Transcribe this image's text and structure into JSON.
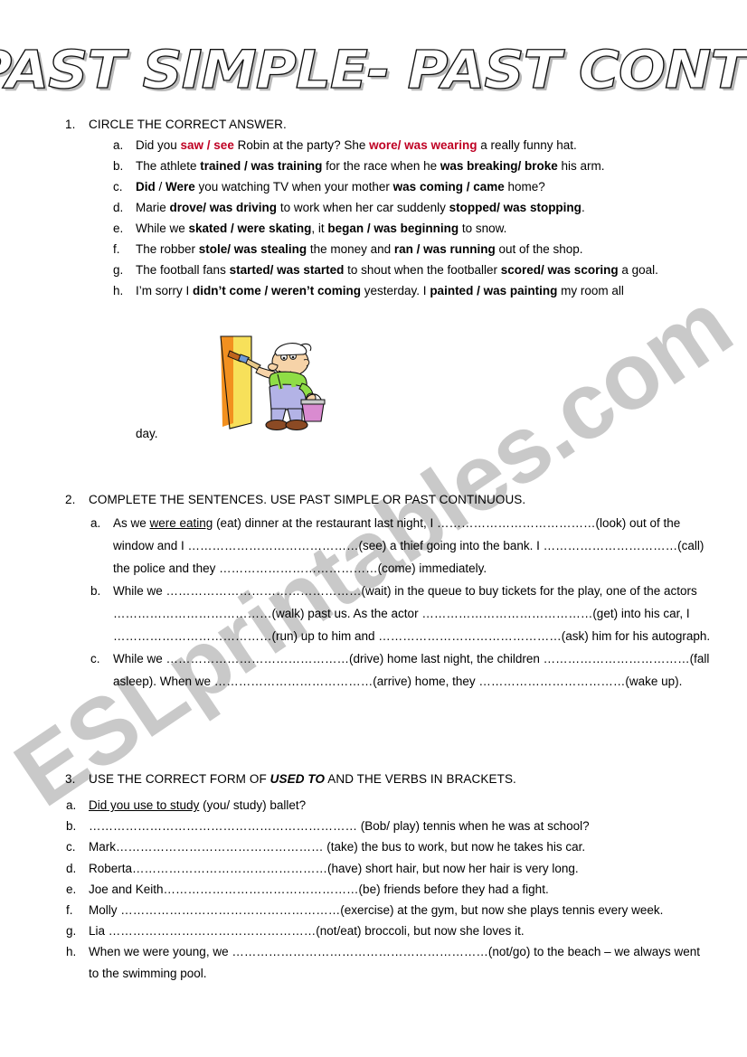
{
  "watermark": {
    "text": "ESLprintables.com"
  },
  "title": {
    "text": "PAST SIMPLE- PAST CONTINUOUS"
  },
  "colors": {
    "accent_red": "#bf0023",
    "watermark_gray": "#c9c9c9",
    "text": "#000000"
  },
  "sections": [
    {
      "number": "1.",
      "heading": "CIRCLE THE CORRECT ANSWER.",
      "items": [
        {
          "letter": "a.",
          "text": "Did you saw / see Robin at the party? She wore/ was wearing a really funny hat."
        },
        {
          "letter": "b.",
          "text": "The athlete trained / was training for the race when he was breaking/ broke his arm."
        },
        {
          "letter": "c.",
          "text": "Did / Were you watching TV when your mother was coming / came home?"
        },
        {
          "letter": "d.",
          "text": "Marie drove/ was driving to work when her car suddenly stopped/ was stopping."
        },
        {
          "letter": "e.",
          "text": "While we skated / were skating, it began / was beginning to snow."
        },
        {
          "letter": "f.",
          "text": "The robber stole/ was stealing the money and ran / was running out of the shop."
        },
        {
          "letter": "g.",
          "text": "The football fans started/ was started to shout when the footballer scored/ was scoring a goal."
        },
        {
          "letter": "h.",
          "text": "I’m sorry I didn’t come / weren’t coming yesterday. I painted / was painting my room all"
        }
      ],
      "trailing_text": "day."
    },
    {
      "number": "2.",
      "heading": "COMPLETE THE SENTENCES. USE PAST SIMPLE OR PAST CONTINUOUS.",
      "items": [
        {
          "letter": "a.",
          "text": "As we were eating (eat) dinner at the restaurant last night, I …………………………………(look) out of the window and I ……………………………………(see) a thief going into the bank. I ……………………………(call) the police and they …………………………………(come) immediately."
        },
        {
          "letter": "b.",
          "text": "While we …………………………………………(wait) in the queue to buy tickets for the play, one of the actors …………………………………(walk) past us. As the actor ……………………………………(get) into his car, I …………………………………(run) up to him and ………………………………………(ask) him for his autograph."
        },
        {
          "letter": "c.",
          "text": "While we ………………………………………(drive) home last night, the children ………………………………(fall asleep). When we …………………………………(arrive) home, they ………………………………(wake up)."
        }
      ],
      "answers_shown": [
        "were eating"
      ]
    },
    {
      "number": "3.",
      "heading": "USE THE CORRECT FORM OF USED TO AND THE VERBS IN BRACKETS.",
      "heading_emphasis": "USED TO",
      "items": [
        {
          "letter": "a.",
          "text": "Did you use to study (you/ study) ballet?"
        },
        {
          "letter": "b.",
          "text": "………………………………………………………… (Bob/ play) tennis when he was at school?"
        },
        {
          "letter": "c.",
          "text": "Mark…………………………………………… (take) the bus to work, but now he takes his car."
        },
        {
          "letter": "d.",
          "text": "Roberta…………………………………………(have) short hair, but now her hair is very long."
        },
        {
          "letter": "e.",
          "text": "Joe and Keith…………………………………………(be) friends before they had a fight."
        },
        {
          "letter": "f.",
          "text": "Molly ………………………………………………(exercise) at the gym, but now she plays tennis every week."
        },
        {
          "letter": "g.",
          "text": "Lia ……………………………………………(not/eat) broccoli, but now she loves it."
        },
        {
          "letter": "h.",
          "text": "When we were young, we ………………………………………………………(not/go) to the beach – we always went to the swimming pool."
        }
      ],
      "answers_shown": [
        "Did you use to study"
      ]
    }
  ],
  "illustration": {
    "name": "painter-clipart",
    "description": "Cartoon man painting a wall with a brush and holding a paint bucket",
    "colors": {
      "wall": "#f7c948",
      "wall_shade": "#f08b1d",
      "shirt": "#8fdd46",
      "overalls": "#b3b3e6",
      "skin": "#f6d3a8",
      "bucket": "#d98bd0",
      "shoes": "#8b4a24",
      "hat": "#ffffff"
    }
  }
}
